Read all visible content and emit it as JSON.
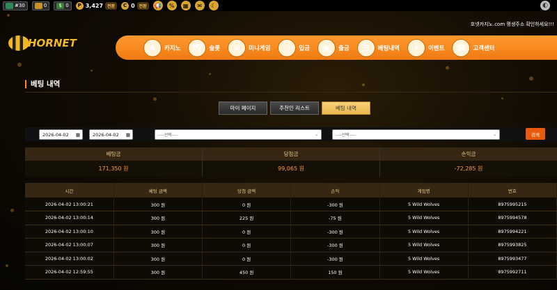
{
  "topbar": {
    "chips": [
      {
        "icon": "piggy-bank-icon",
        "value": "#30",
        "color": "#2e8b57"
      },
      {
        "icon": "coin-stack-icon",
        "value": "0",
        "color": "#c8922a"
      },
      {
        "icon": "dollar-icon",
        "value": "0",
        "color": "#3a7d3a"
      }
    ],
    "points_icon": "P",
    "points": "3,427",
    "points_btn": "전환",
    "coin_icon": "C",
    "coins": "0",
    "coins_btn": "전환",
    "icons": [
      "megaphone-icon",
      "percent-icon",
      "gift-icon",
      "chat-icon",
      "moon-icon"
    ],
    "notice": "호넷카지노.com 평생주소 확인하세요!!!"
  },
  "logo": {
    "text": "HORNET"
  },
  "nav": [
    {
      "label": "카지노",
      "icon": "casino-icon",
      "glyph": "♠"
    },
    {
      "label": "슬롯",
      "icon": "slot-icon",
      "glyph": "🕊"
    },
    {
      "label": "미니게임",
      "icon": "minigame-icon",
      "glyph": "♛"
    },
    {
      "label": "입금",
      "icon": "deposit-icon",
      "glyph": "◎"
    },
    {
      "label": "출금",
      "icon": "withdraw-icon",
      "glyph": "▣"
    },
    {
      "label": "베팅내역",
      "icon": "betting-history-icon",
      "glyph": "☰"
    },
    {
      "label": "이벤트",
      "icon": "event-icon",
      "glyph": "✦"
    },
    {
      "label": "고객센터",
      "icon": "support-icon",
      "glyph": "☎"
    }
  ],
  "page_title": "베팅 내역",
  "tabs": [
    {
      "label": "마이 페이지",
      "active": false
    },
    {
      "label": "추천인 리스트",
      "active": false
    },
    {
      "label": "베팅 내역",
      "active": true
    }
  ],
  "filter": {
    "date_from": "2026-04-02",
    "date_to": "2026-04-02",
    "select1": "----선택----",
    "select2": "----선택----",
    "search_label": "검색"
  },
  "summary": [
    {
      "label": "베팅금",
      "value": "171,350 원"
    },
    {
      "label": "당첨금",
      "value": "99,065 원"
    },
    {
      "label": "손익금",
      "value": "-72,285 원"
    }
  ],
  "table": {
    "headers": [
      "시간",
      "베팅 금액",
      "당첨 금액",
      "손익",
      "게임명",
      "번호"
    ],
    "rows": [
      [
        "2026-04-02 13:00:21",
        "300 원",
        "0 원",
        "-300 원",
        "5 Wild Wolves",
        "8975995215"
      ],
      [
        "2026-04-02 13:00:14",
        "300 원",
        "225 원",
        "-75 원",
        "5 Wild Wolves",
        "8975994578"
      ],
      [
        "2026-04-02 13:00:10",
        "300 원",
        "0 원",
        "-300 원",
        "5 Wild Wolves",
        "8975994221"
      ],
      [
        "2026-04-02 13:00:07",
        "300 원",
        "0 원",
        "-300 원",
        "5 Wild Wolves",
        "8975993825"
      ],
      [
        "2026-04-02 13:00:02",
        "300 원",
        "0 원",
        "-300 원",
        "5 Wild Wolves",
        "8975993477"
      ],
      [
        "2026-04-02 12:59:55",
        "300 원",
        "450 원",
        "150 원",
        "5 Wild Wolves",
        "8975992711"
      ]
    ]
  }
}
